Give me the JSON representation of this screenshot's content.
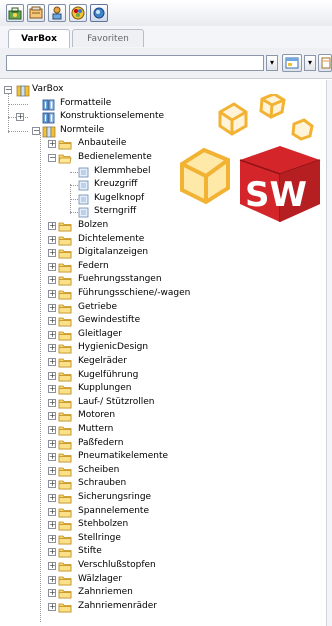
{
  "toolbar": {
    "icons": [
      "toolbox-icon",
      "settings-icon",
      "library-icon",
      "palette-icon",
      "varbox-icon"
    ]
  },
  "tabs": [
    {
      "label": "VarBox",
      "active": true
    },
    {
      "label": "Favoriten",
      "active": false
    }
  ],
  "search": {
    "value": "",
    "placeholder": ""
  },
  "tree": {
    "root": "VarBox",
    "nodes": [
      {
        "label": "Formatteile",
        "level": 1
      },
      {
        "label": "Konstruktionselemente",
        "level": 1
      },
      {
        "label": "Normteile",
        "level": 1
      },
      {
        "label": "Anbauteile",
        "level": 2
      },
      {
        "label": "Bedienelemente",
        "level": 2
      },
      {
        "label": "Klemmhebel",
        "level": 3
      },
      {
        "label": "Kreuzgriff",
        "level": 3
      },
      {
        "label": "Kugelknopf",
        "level": 3
      },
      {
        "label": "Sterngriff",
        "level": 3
      },
      {
        "label": "Bolzen",
        "level": 2
      },
      {
        "label": "Dichtelemente",
        "level": 2
      },
      {
        "label": "Digitalanzeigen",
        "level": 2
      },
      {
        "label": "Federn",
        "level": 2
      },
      {
        "label": "Fuehrungsstangen",
        "level": 2
      },
      {
        "label": "Führungsschiene/-wagen",
        "level": 2
      },
      {
        "label": "Getriebe",
        "level": 2
      },
      {
        "label": "Gewindestifte",
        "level": 2
      },
      {
        "label": "Gleitlager",
        "level": 2
      },
      {
        "label": "HygienicDesign",
        "level": 2
      },
      {
        "label": "Kegelräder",
        "level": 2
      },
      {
        "label": "Kugelführung",
        "level": 2
      },
      {
        "label": "Kupplungen",
        "level": 2
      },
      {
        "label": "Lauf-/ Stützrollen",
        "level": 2
      },
      {
        "label": "Motoren",
        "level": 2
      },
      {
        "label": "Muttern",
        "level": 2
      },
      {
        "label": "Paßfedern",
        "level": 2
      },
      {
        "label": "Pneumatikelemente",
        "level": 2
      },
      {
        "label": "Scheiben",
        "level": 2
      },
      {
        "label": "Schrauben",
        "level": 2
      },
      {
        "label": "Sicherungsringe",
        "level": 2
      },
      {
        "label": "Spannelemente",
        "level": 2
      },
      {
        "label": "Stehbolzen",
        "level": 2
      },
      {
        "label": "Stellringe",
        "level": 2
      },
      {
        "label": "Stifte",
        "level": 2
      },
      {
        "label": "Verschlußstopfen",
        "level": 2
      },
      {
        "label": "Wälzlager",
        "level": 2
      },
      {
        "label": "Zahnriemen",
        "level": 2
      },
      {
        "label": "Zahnriemenräder",
        "level": 2
      }
    ]
  },
  "logo": {
    "text": "SW",
    "color": "#d4262a"
  }
}
